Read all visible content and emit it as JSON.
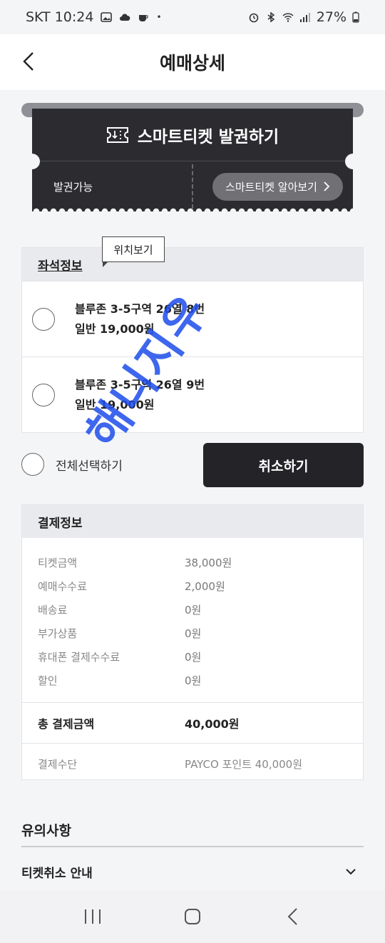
{
  "status_bar": {
    "carrier_time": "SKT 10:24",
    "battery": "27%"
  },
  "header": {
    "title": "예매상세"
  },
  "ticket": {
    "issue_label": "스마트티켓 발권하기",
    "status": "발권가능",
    "learn_more": "스마트티켓 알아보기"
  },
  "seat_info": {
    "title": "좌석정보",
    "tooltip": "위치보기",
    "seats": [
      {
        "line1": "블루존 3-5구역 26열 8번",
        "line2": "일반 19,000원"
      },
      {
        "line1": "블루존 3-5구역 26열 9번",
        "line2": "일반 19,000원"
      }
    ]
  },
  "actions": {
    "select_all": "전체선택하기",
    "cancel": "취소하기"
  },
  "payment": {
    "title": "결제정보",
    "rows": [
      {
        "label": "티켓금액",
        "value": "38,000원"
      },
      {
        "label": "예매수수료",
        "value": "2,000원"
      },
      {
        "label": "배송료",
        "value": "0원"
      },
      {
        "label": "부가상품",
        "value": "0원"
      },
      {
        "label": "휴대폰 결제수수료",
        "value": "0원"
      },
      {
        "label": "할인",
        "value": "0원"
      }
    ],
    "total_label": "총 결제금액",
    "total_value": "40,000원",
    "method_label": "결제수단",
    "method_value": "PAYCO 포인트 40,000원"
  },
  "notes": {
    "title": "유의사항",
    "item": "티켓취소 안내"
  },
  "watermark": "해니지우"
}
